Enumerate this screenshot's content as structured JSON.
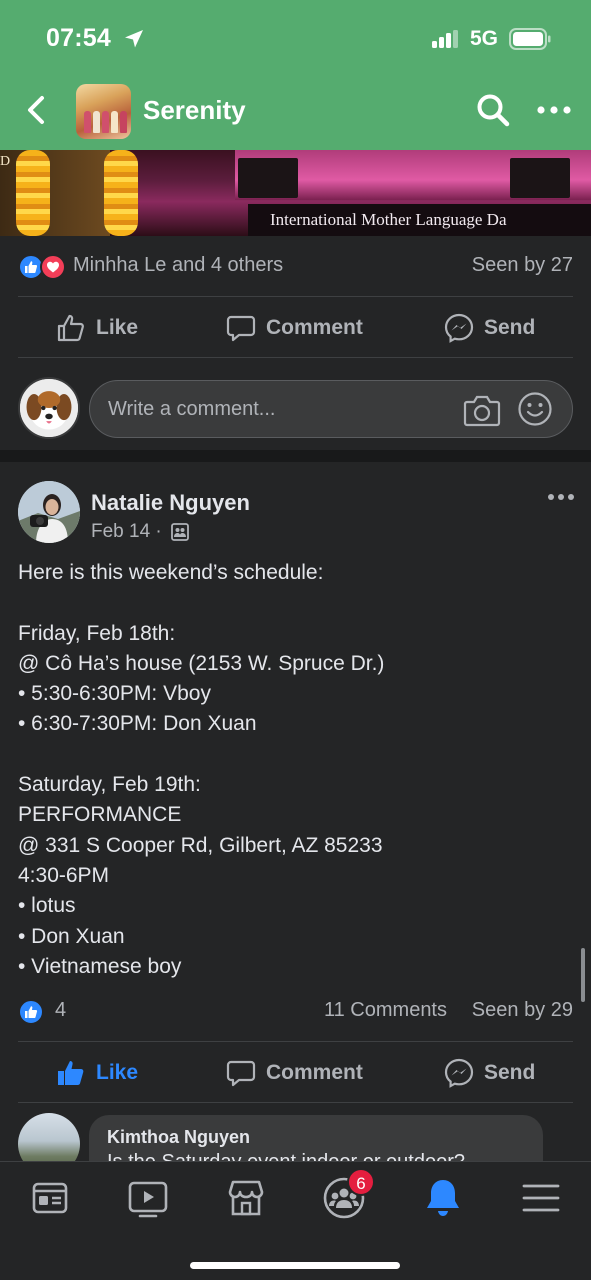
{
  "status_bar": {
    "time": "07:54",
    "network": "5G"
  },
  "nav": {
    "group_name": "Serenity"
  },
  "banner": {
    "caption": "International  Mother  Language  Da",
    "edge_letter": "D"
  },
  "first_post": {
    "reactors_text": "Minhha Le and 4 others",
    "seen_text": "Seen by 27",
    "actions": {
      "like": "Like",
      "comment": "Comment",
      "send": "Send"
    },
    "comment_placeholder": "Write a comment..."
  },
  "post": {
    "author": "Natalie Nguyen",
    "date": "Feb 14 ·",
    "body": "Here is this weekend’s schedule:\n\nFriday, Feb 18th:\n@ Cô Ha’s house (2153 W. Spruce Dr.)\n• 5:30-6:30PM: Vboy\n• 6:30-7:30PM: Don Xuan\n\nSaturday, Feb 19th:\nPERFORMANCE\n@ 331 S Cooper Rd, Gilbert, AZ 85233\n4:30-6PM\n• lotus\n• Don Xuan\n• Vietnamese boy",
    "like_count": "4",
    "comments_text": "11 Comments",
    "seen_text": "Seen by 29",
    "actions": {
      "like": "Like",
      "comment": "Comment",
      "send": "Send"
    },
    "reply": {
      "name": "Kimthoa Nguyen",
      "text_plain": "Is the Saturday event indoor ",
      "text_underlined": "or outdoor",
      "text_end": "?"
    }
  },
  "tabbar": {
    "notification_badge": "6"
  },
  "colors": {
    "header_green": "#55ac6f",
    "accent_blue": "#2d88ff",
    "badge_red": "#e41e3f",
    "background": "#242526"
  },
  "icons": [
    "location-arrow-icon",
    "signal-icon",
    "battery-icon",
    "back-icon",
    "search-icon",
    "more-icon",
    "like-icon",
    "comment-icon",
    "messenger-icon",
    "camera-icon",
    "emoji-icon",
    "audience-icon",
    "feed-icon",
    "video-icon",
    "marketplace-icon",
    "groups-icon",
    "bell-icon",
    "menu-icon"
  ]
}
